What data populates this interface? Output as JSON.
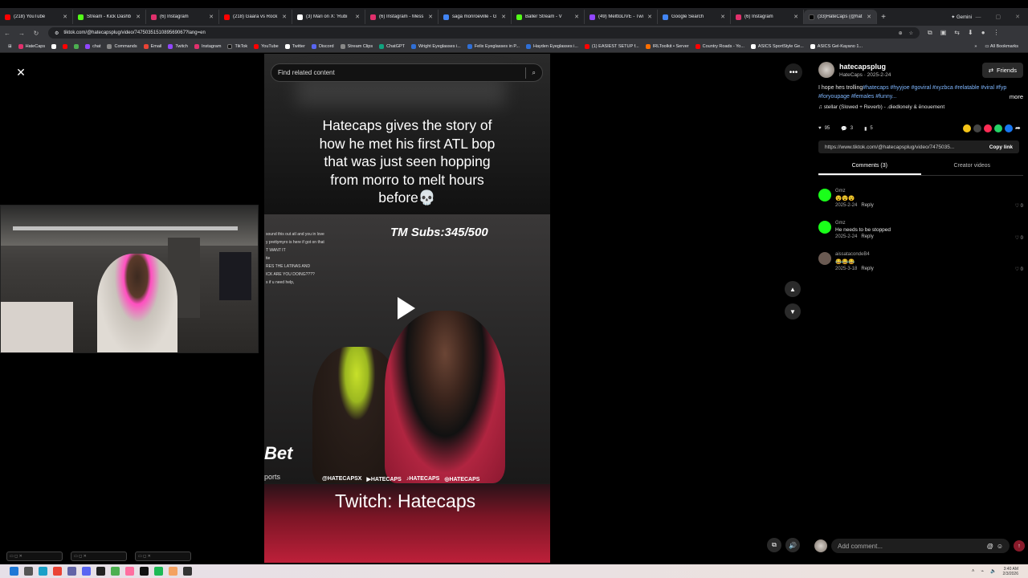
{
  "browser": {
    "tabs": [
      {
        "title": "(218) YouTube",
        "color": "#ff0000"
      },
      {
        "title": "Stream - Kick Dashb",
        "color": "#53fc18"
      },
      {
        "title": "(6) Instagram",
        "color": "#e1306c"
      },
      {
        "title": "(218) Gaara vs Rock",
        "color": "#ff0000"
      },
      {
        "title": "(3) Mari on X: 'Rubi",
        "color": "#ffffff"
      },
      {
        "title": "(6) Instagram - Mess",
        "color": "#e1306c"
      },
      {
        "title": "saga monroeville - G",
        "color": "#4285f4"
      },
      {
        "title": "Baller Stream - V",
        "color": "#53fc18"
      },
      {
        "title": "(49) MelttoLIVE - Twi",
        "color": "#9146ff"
      },
      {
        "title": "Google Search",
        "color": "#4285f4"
      },
      {
        "title": "(6) Instagram",
        "color": "#e1306c"
      },
      {
        "title": "(33)HateCaps (@hat",
        "color": "#000000"
      }
    ],
    "gemini": "Gemini",
    "url": "tiktok.com/@hatecapsplug/video/7475035151089569067?lang=en",
    "bookmarks": [
      {
        "label": "HateCaps",
        "color": "#e1306c"
      },
      {
        "label": "",
        "color": "#ffffff"
      },
      {
        "label": "",
        "color": "#ff0000"
      },
      {
        "label": "",
        "color": "#4caf50"
      },
      {
        "label": "chat",
        "color": "#9146ff"
      },
      {
        "label": "Commands",
        "color": "#888888"
      },
      {
        "label": "Email",
        "color": "#ea4335"
      },
      {
        "label": "Twitch",
        "color": "#9146ff"
      },
      {
        "label": "Instagram",
        "color": "#e1306c"
      },
      {
        "label": "TikTok",
        "color": "#111111"
      },
      {
        "label": "YouTube",
        "color": "#ff0000"
      },
      {
        "label": "Twitter",
        "color": "#ffffff"
      },
      {
        "label": "Discord",
        "color": "#5865f2"
      },
      {
        "label": "Stream Clips",
        "color": "#888888"
      },
      {
        "label": "ChatGPT",
        "color": "#10a37f"
      },
      {
        "label": "Wright Eyeglasses i...",
        "color": "#2f6fd6"
      },
      {
        "label": "Felix Eyeglasses in P...",
        "color": "#2f6fd6"
      },
      {
        "label": "Hayden Eyeglasses i...",
        "color": "#2f6fd6"
      },
      {
        "label": "(1) EASIEST SETUP f...",
        "color": "#ff0000"
      },
      {
        "label": "IRLToolkit • Server",
        "color": "#ff6f00"
      },
      {
        "label": "Country Roads - Yo...",
        "color": "#ff0000"
      },
      {
        "label": "ASICS SportStyle Ge...",
        "color": "#ffffff"
      },
      {
        "label": "ASICS Gel-Kayano 1...",
        "color": "#ffffff"
      }
    ],
    "all_bookmarks": "All Bookmarks"
  },
  "viewer": {
    "search_placeholder": "Find related content",
    "caption": "Hatecaps gives the story of how he met his first ATL bop that was just seen hopping from morro to melt hours before💀",
    "subs": "TM Subs:345/500",
    "chat_lines": [
      "sound this out atl and you in love",
      "y prettymyro is here if got on that",
      "T WANT IT",
      "tie",
      "RES THE LATINAS AND",
      "ICK ARE YOU DOING????",
      "s if u need help,"
    ],
    "handles": [
      "@HATECAPSX",
      "▶HATECAPS",
      "♪HATECAPS",
      "◎HATECAPS"
    ],
    "overlay_logo": "Bet",
    "overlay_logo2": "ports",
    "twitch_text": "Twitch: Hatecaps"
  },
  "post": {
    "username": "hatecapsplug",
    "subline": "HateCaps · 2025-2-24",
    "friends_button": "Friends",
    "description_text": "I hope hes trolling",
    "hashtags": "#hatecaps #hyyjoe #goviral #xyzbca #relatable #viral #fyp #foryoupage #females #funny...",
    "more": "more",
    "music": "stellar (Slowed + Reverb) - .diedlonely & ēnouement",
    "likes": "95",
    "comments_count": "3",
    "saves": "5",
    "link": "https://www.tiktok.com/@hatecapsplug/video/7475035...",
    "copy_link": "Copy link",
    "tab_comments": "Comments (3)",
    "tab_creator": "Creator videos",
    "comments": [
      {
        "name": "Gmz",
        "text": "😵😵😵",
        "date": "2025-2-24",
        "reply": "Reply",
        "likes": "0",
        "color": "#1aff1a"
      },
      {
        "name": "Gmz",
        "text": "He needs to be stopped",
        "date": "2025-2-24",
        "reply": "Reply",
        "likes": "0",
        "color": "#1aff1a"
      },
      {
        "name": "aissatacondeB4",
        "text": "😂😂😂",
        "date": "2025-3-18",
        "reply": "Reply",
        "likes": "0",
        "color": "#6a5a52"
      }
    ],
    "add_comment_placeholder": "Add comment..."
  },
  "taskbar": {
    "time": "3:40 AM",
    "date": "2/3/2026"
  }
}
